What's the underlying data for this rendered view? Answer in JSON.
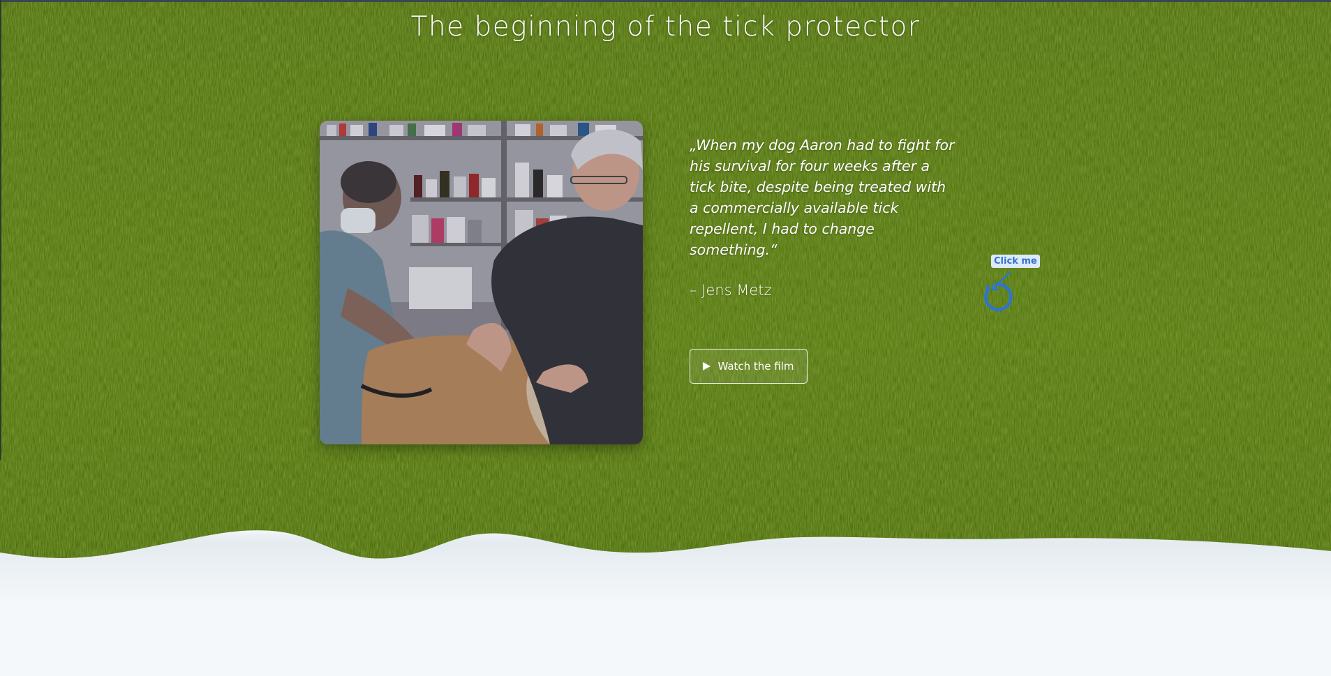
{
  "page": {
    "title": "The beginning of the tick protector"
  },
  "story": {
    "photo_alt": "Veterinarian examining a dog with its owner in a pharmacy",
    "quote": "„When my dog Aaron had to fight for his survival for four weeks after a tick bite, despite being treated with a commercially available tick repellent, I had to change something.“",
    "author": "– Jens Metz",
    "watch_button_label": "Watch the film"
  },
  "hint": {
    "label": "Click me"
  },
  "icons": {
    "play": "play-icon",
    "hint_target": "tap-target-icon"
  },
  "colors": {
    "grass_dark": "#3f5f0c",
    "grass_mid": "#4e7212",
    "grass_light": "#5f8418",
    "ground": "#f4f7fa",
    "hint_blue": "#2f74d0",
    "hint_label_bg": "#dfeaf8",
    "text": "#ffffff"
  }
}
